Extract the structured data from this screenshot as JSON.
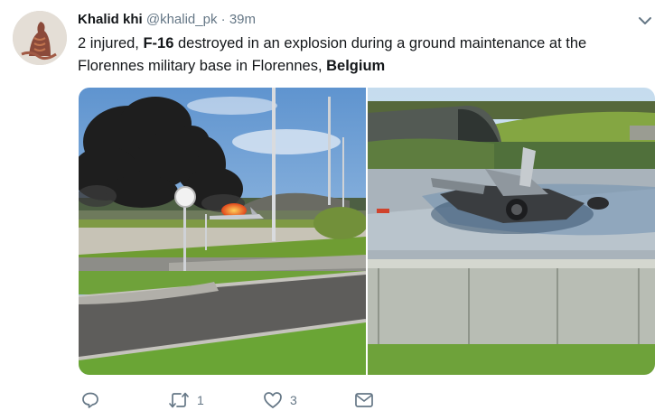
{
  "tweet": {
    "author_name": "Khalid khi",
    "author_handle": "@khalid_pk",
    "separator": "·",
    "time": "39m",
    "text_parts": {
      "p1": "2 injured, ",
      "p2": "F-16",
      "p3": " destroyed in an explosion during a ground maintenance at the Florennes military base in Florennes, ",
      "p4": "Belgium"
    }
  },
  "actions": {
    "reply": {
      "icon": "reply-icon",
      "count": ""
    },
    "retweet": {
      "icon": "retweet-icon",
      "count": "1"
    },
    "like": {
      "icon": "heart-icon",
      "count": "3"
    },
    "dm": {
      "icon": "envelope-icon"
    }
  },
  "colors": {
    "text": "#14171a",
    "secondary": "#657786",
    "icon": "#657786"
  }
}
